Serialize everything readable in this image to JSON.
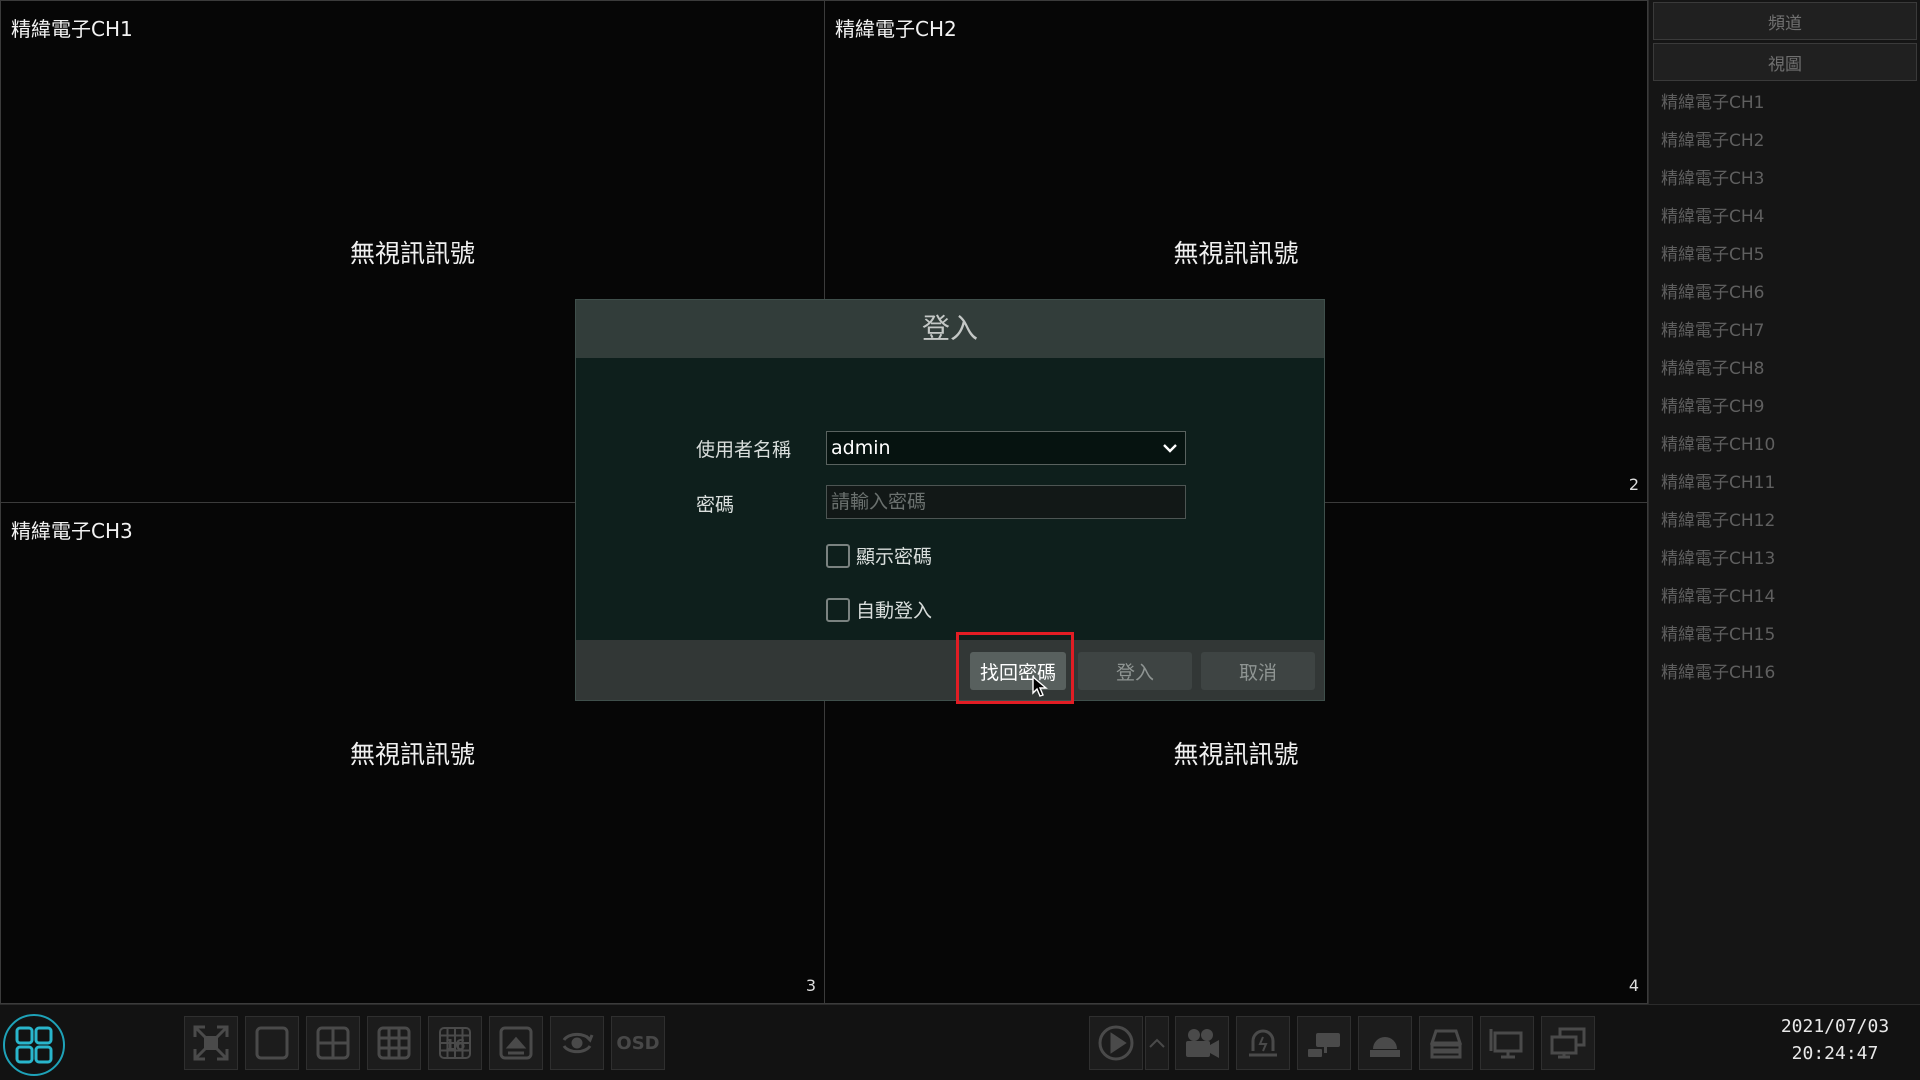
{
  "tiles": [
    {
      "name": "精緯電子CH1",
      "status": "無視訊訊號",
      "number": ""
    },
    {
      "name": "精緯電子CH2",
      "status": "無視訊訊號",
      "number": "2"
    },
    {
      "name": "精緯電子CH3",
      "status": "無視訊訊號",
      "number": "3"
    },
    {
      "name": "",
      "status": "無視訊訊號",
      "number": "4"
    }
  ],
  "sidebar": {
    "tabs": [
      "頻道",
      "視圖"
    ],
    "channels": [
      "精緯電子CH1",
      "精緯電子CH2",
      "精緯電子CH3",
      "精緯電子CH4",
      "精緯電子CH5",
      "精緯電子CH6",
      "精緯電子CH7",
      "精緯電子CH8",
      "精緯電子CH9",
      "精緯電子CH10",
      "精緯電子CH11",
      "精緯電子CH12",
      "精緯電子CH13",
      "精緯電子CH14",
      "精緯電子CH15",
      "精緯電子CH16"
    ]
  },
  "dialog": {
    "title": "登入",
    "username_label": "使用者名稱",
    "username_value": "admin",
    "password_label": "密碼",
    "password_placeholder": "請輸入密碼",
    "show_password": "顯示密碼",
    "auto_login": "自動登入",
    "recover_button": "找回密碼",
    "login_button": "登入",
    "cancel_button": "取消"
  },
  "taskbar": {
    "osd_label": "OSD",
    "grid16_label": "16",
    "date": "2021/07/03",
    "time": "20:24:47"
  },
  "colors": {
    "accent": "#1ea2b8",
    "highlight": "#e11d24",
    "dialog_bg": "#0e1f1c",
    "dialog_header": "#323d3a"
  }
}
